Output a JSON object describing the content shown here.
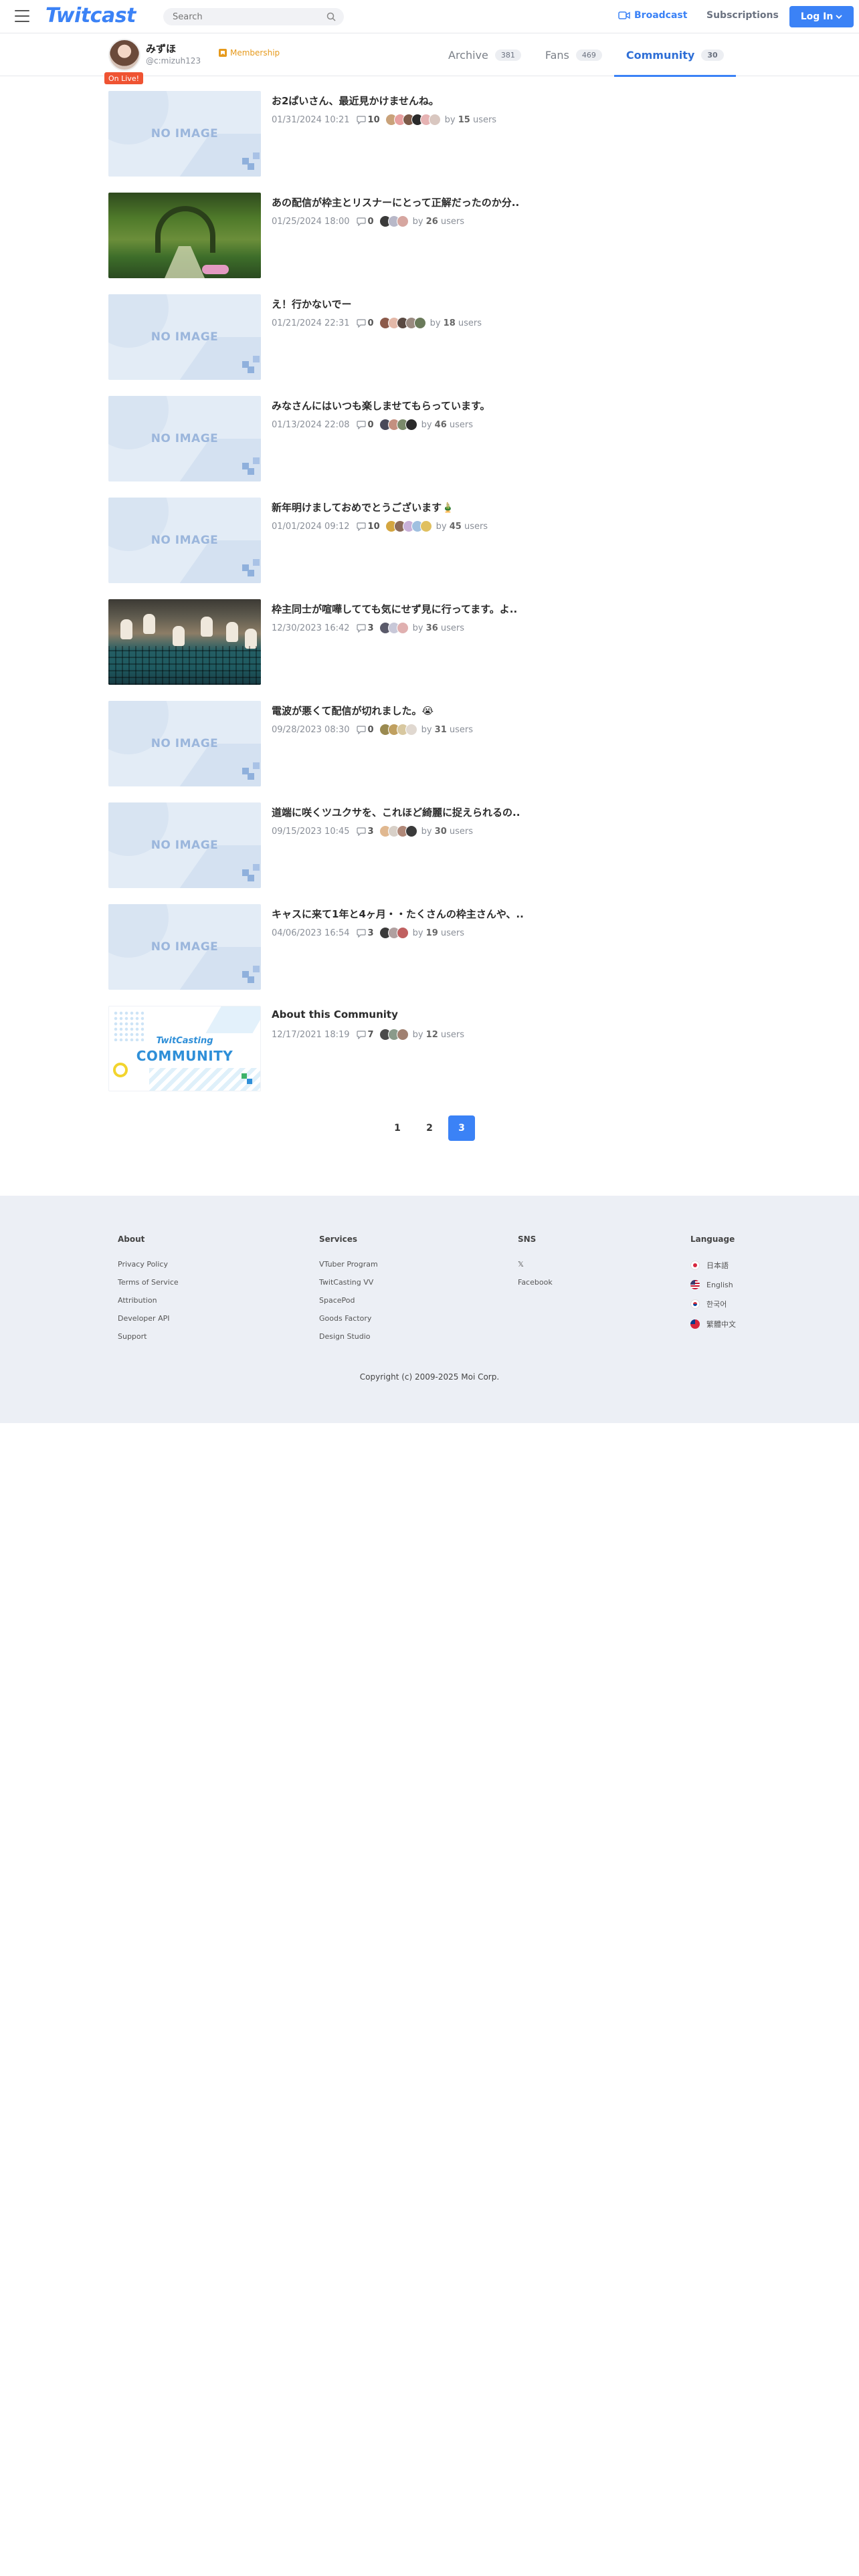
{
  "header": {
    "logo": "Twitcast",
    "search_placeholder": "Search",
    "broadcast": "Broadcast",
    "subscriptions": "Subscriptions",
    "login": "Log In"
  },
  "profile": {
    "name": "みずほ",
    "handle": "@c:mizuh123",
    "live_badge": "On Live!",
    "membership": "Membership"
  },
  "tabs": [
    {
      "label": "Archive",
      "count": "381"
    },
    {
      "label": "Fans",
      "count": "469"
    },
    {
      "label": "Community",
      "count": "30"
    }
  ],
  "posts": [
    {
      "title": "お2ぱいさん、最近見かけませんね。",
      "date": "01/31/2024 10:21",
      "comments": "10",
      "by_prefix": "by",
      "users": "15",
      "users_suffix": "users",
      "thumb": "noimage",
      "faces": [
        "#c9a27a",
        "#e8a0a0",
        "#7c5a48",
        "#2a2a2a",
        "#e6b3b3",
        "#d9c7c0"
      ]
    },
    {
      "title": "あの配信が枠主とリスナーにとって正解だったのか分..",
      "date": "01/25/2024 18:00",
      "comments": "0",
      "by_prefix": "by",
      "users": "26",
      "users_suffix": "users",
      "thumb": "garden",
      "faces": [
        "#3a3a3a",
        "#b8b8c8",
        "#d6a6a0"
      ]
    },
    {
      "title": "え！行かないでー",
      "date": "01/21/2024 22:31",
      "comments": "0",
      "by_prefix": "by",
      "users": "18",
      "users_suffix": "users",
      "thumb": "noimage",
      "faces": [
        "#8c5a4a",
        "#e3b8a8",
        "#5a4a42",
        "#9a8a80",
        "#6a7a5a"
      ]
    },
    {
      "title": "みなさんにはいつも楽しませてもらっています。",
      "date": "01/13/2024 22:08",
      "comments": "0",
      "by_prefix": "by",
      "users": "46",
      "users_suffix": "users",
      "thumb": "noimage",
      "faces": [
        "#4a4a5a",
        "#c49080",
        "#7a8a6a",
        "#2a2a2a"
      ]
    },
    {
      "title": "新年明けましておめでとうございます🎍",
      "date": "01/01/2024 09:12",
      "comments": "10",
      "by_prefix": "by",
      "users": "45",
      "users_suffix": "users",
      "thumb": "noimage",
      "faces": [
        "#d4a640",
        "#8a6a5a",
        "#c8b0d8",
        "#a0c0e0",
        "#e0c060"
      ]
    },
    {
      "title": "枠主同士が喧嘩してても気にせず見に行ってます。よ..",
      "date": "12/30/2023 16:42",
      "comments": "3",
      "by_prefix": "by",
      "users": "36",
      "users_suffix": "users",
      "thumb": "cats",
      "faces": [
        "#5a5a6a",
        "#c8c8d8",
        "#e0b0b0"
      ]
    },
    {
      "title": "電波が悪くて配信が切れました。😭",
      "date": "09/28/2023 08:30",
      "comments": "0",
      "by_prefix": "by",
      "users": "31",
      "users_suffix": "users",
      "thumb": "noimage",
      "faces": [
        "#9a8a50",
        "#c0a060",
        "#d8c8a0",
        "#e0d8d0"
      ]
    },
    {
      "title": "道端に咲くツユクサを、これほど綺麗に捉えられるの..",
      "date": "09/15/2023 10:45",
      "comments": "3",
      "by_prefix": "by",
      "users": "30",
      "users_suffix": "users",
      "thumb": "noimage",
      "faces": [
        "#e0b890",
        "#d8d0c8",
        "#b08878",
        "#3a3a3a"
      ]
    },
    {
      "title": "キャスに来て1年と4ヶ月・・たくさんの枠主さんや、..",
      "date": "04/06/2023 16:54",
      "comments": "3",
      "by_prefix": "by",
      "users": "19",
      "users_suffix": "users",
      "thumb": "noimage",
      "faces": [
        "#3a3a3a",
        "#b0a0a0",
        "#c06060"
      ]
    },
    {
      "title": "About this Community",
      "date": "12/17/2021 18:19",
      "comments": "7",
      "by_prefix": "by",
      "users": "12",
      "users_suffix": "users",
      "thumb": "community",
      "faces": [
        "#4a4a4a",
        "#8a9a8a",
        "#a08070"
      ]
    }
  ],
  "community_thumb": {
    "brand": "TwitCasting",
    "label": "COMMUNITY"
  },
  "noimage_text": "NO IMAGE",
  "pagination": [
    "1",
    "2",
    "3"
  ],
  "current_page": "3",
  "footer": {
    "about": {
      "heading": "About",
      "links": [
        "Privacy Policy",
        "Terms of Service",
        "Attribution",
        "Developer API",
        "Support"
      ]
    },
    "services": {
      "heading": "Services",
      "links": [
        "VTuber Program",
        "TwitCasting VV",
        "SpacePod",
        "Goods Factory",
        "Design Studio"
      ]
    },
    "sns": {
      "heading": "SNS",
      "links": [
        "𝕏",
        "Facebook"
      ]
    },
    "language": {
      "heading": "Language",
      "links": [
        "日本語",
        "English",
        "한국어",
        "繁體中文"
      ]
    },
    "copyright": "Copyright (c) 2009-2025 Moi Corp."
  },
  "colors": {
    "accent": "#3b82f6",
    "live": "#ef5332",
    "membership": "#e69a1d"
  }
}
